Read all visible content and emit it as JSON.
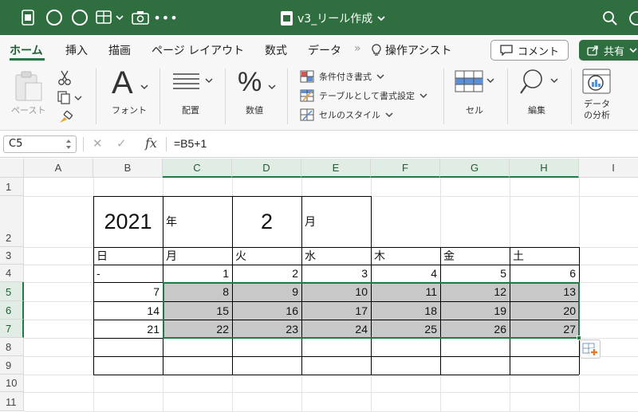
{
  "titlebar": {
    "document_title": "v3_リール作成",
    "qa_icons": [
      "excel-doc-icon",
      "autosave-circle-icon",
      "undo-circle-icon",
      "table-grid-icon",
      "camera-icon",
      "more-icon"
    ],
    "right_icons": [
      "search-icon",
      "smiley-icon"
    ]
  },
  "tabs": {
    "items": [
      "ホーム",
      "挿入",
      "描画",
      "ページ レイアウト",
      "数式",
      "データ"
    ],
    "more": "»",
    "tell_me": "操作アシスト",
    "active": "ホーム",
    "comment_label": "コメント",
    "share_label": "共有"
  },
  "ribbon": {
    "paste_label": "ペースト",
    "font_label": "フォント",
    "alignment_label": "配置",
    "number_label": "数値",
    "cond_format_label": "条件付き書式",
    "table_format_label": "テーブルとして書式設定",
    "cell_styles_label": "セルのスタイル",
    "cells_label": "セル",
    "editing_label": "編集",
    "analyze_label_1": "データ",
    "analyze_label_2": "の分析",
    "font_glyph": "A",
    "number_glyph": "%"
  },
  "formula_bar": {
    "name_box": "C5",
    "cancel_glyph": "✕",
    "enter_glyph": "✓",
    "fx_glyph": "fx",
    "formula": "=B5+1"
  },
  "sheet": {
    "columns": [
      "A",
      "B",
      "C",
      "D",
      "E",
      "F",
      "G",
      "H",
      "I"
    ],
    "selected_columns": [
      "C",
      "D",
      "E",
      "F",
      "G",
      "H"
    ],
    "rows": [
      "1",
      "2",
      "3",
      "4",
      "5",
      "6",
      "7",
      "8",
      "9",
      "10",
      "11"
    ],
    "selected_rows": [
      "5",
      "6",
      "7"
    ],
    "year": "2021",
    "year_unit": "年",
    "month": "2",
    "month_unit": "月",
    "weekdays": [
      "日",
      "月",
      "火",
      "水",
      "木",
      "金",
      "土"
    ],
    "week_rows": [
      [
        "-",
        "1",
        "2",
        "3",
        "4",
        "5",
        "6"
      ],
      [
        "7",
        "8",
        "9",
        "10",
        "11",
        "12",
        "13"
      ],
      [
        "14",
        "15",
        "16",
        "17",
        "18",
        "19",
        "20"
      ],
      [
        "21",
        "22",
        "23",
        "24",
        "25",
        "26",
        "27"
      ]
    ],
    "shaded_fill": "#c8c8c8",
    "selection_color": "#1f7a43"
  },
  "colors": {
    "titlebar": "#2f6f3f",
    "accent": "#1f7a43"
  }
}
